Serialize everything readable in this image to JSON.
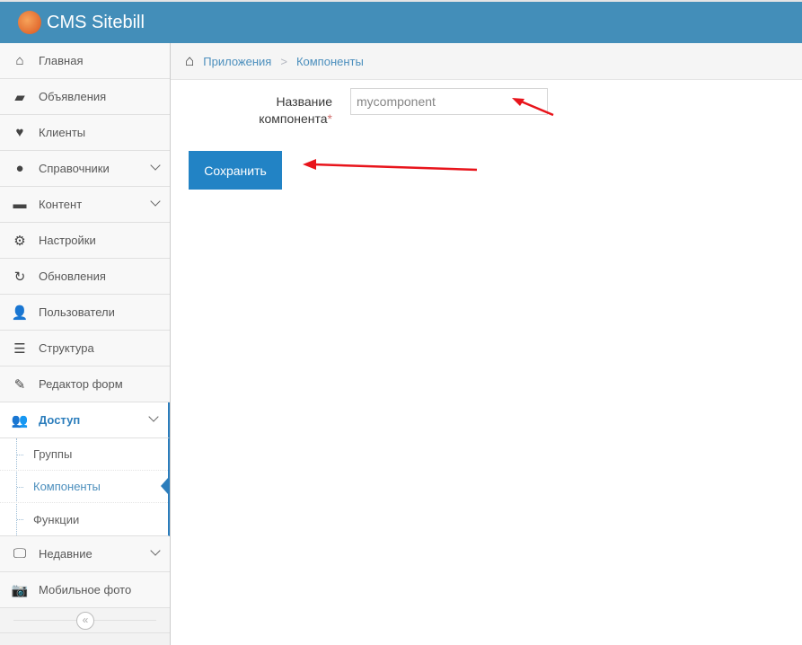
{
  "header": {
    "brand": "CMS Sitebill"
  },
  "sidebar": {
    "items": [
      {
        "label": "Главная",
        "icon": "home-icon"
      },
      {
        "label": "Объявления",
        "icon": "book-icon"
      },
      {
        "label": "Клиенты",
        "icon": "heart-icon"
      },
      {
        "label": "Справочники",
        "icon": "globe-icon"
      },
      {
        "label": "Контент",
        "icon": "coffee-icon"
      },
      {
        "label": "Настройки",
        "icon": "gear-icon"
      },
      {
        "label": "Обновления",
        "icon": "refresh-icon"
      },
      {
        "label": "Пользователи",
        "icon": "user-icon"
      },
      {
        "label": "Структура",
        "icon": "list-icon"
      },
      {
        "label": "Редактор форм",
        "icon": "edit-icon"
      },
      {
        "label": "Доступ",
        "icon": "users-icon"
      },
      {
        "label": "Недавние",
        "icon": "desktop-icon"
      },
      {
        "label": "Мобильное фото",
        "icon": "camera-icon"
      }
    ],
    "submenu": [
      "Группы",
      "Компоненты",
      "Функции"
    ],
    "collapse": "«"
  },
  "breadcrumb": {
    "items": [
      "Приложения",
      "Компоненты"
    ],
    "sep": ">"
  },
  "form": {
    "label_line1": "Название",
    "label_line2": "компонента",
    "required": "*",
    "value": "mycomponent",
    "save": "Сохранить"
  },
  "colors": {
    "header": "#438eb9",
    "primary": "#2283c5",
    "annotation": "#e8141b"
  }
}
